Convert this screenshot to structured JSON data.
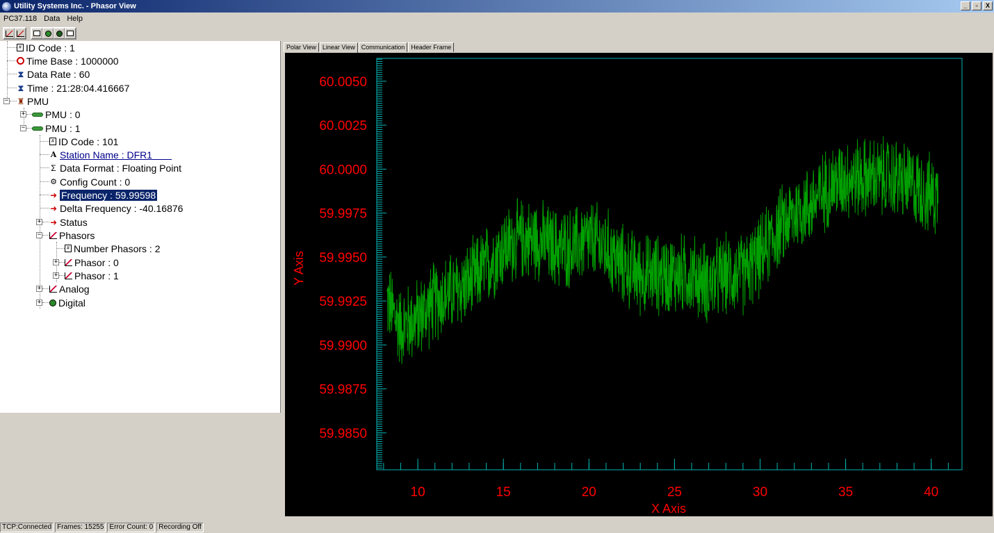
{
  "window": {
    "title": "Utility Systems Inc. - Phasor View",
    "controls": [
      "_",
      "▫",
      "X"
    ]
  },
  "menu": [
    "PC37.118",
    "Data",
    "Help"
  ],
  "toolbar": {
    "icons": [
      "chart-view-icon",
      "data-view-icon",
      "table-icon",
      "connect-icon",
      "record-icon",
      "report-icon"
    ]
  },
  "tree": {
    "id_code": "ID Code : 1",
    "time_base": "Time Base : 1000000",
    "data_rate": "Data Rate : 60",
    "time": "Time : 21:28:04.416667",
    "pmu": "PMU",
    "pmu0": "PMU : 0",
    "pmu1": "PMU : 1",
    "pmu1_id_code": "ID Code : 101",
    "station_name": "Station Name : DFR1",
    "data_format": "Data Format : Floating Point",
    "config_count": "Config Count : 0",
    "frequency": "Frequency : 59.99598",
    "delta_frequency": "Delta Frequency : -40.16876",
    "status": "Status",
    "phasors": "Phasors",
    "number_phasors": "Number Phasors : 2",
    "phasor0": "Phasor : 0",
    "phasor1": "Phasor : 1",
    "analog": "Analog",
    "digital": "Digital"
  },
  "tabs": [
    "Polar View",
    "Linear View",
    "Communication",
    "Header Frame"
  ],
  "active_tab": "Linear View",
  "chart_data": {
    "type": "line",
    "xlabel": "X Axis",
    "ylabel": "Y Axis",
    "xlim": [
      7.6,
      41.8
    ],
    "ylim": [
      59.9829,
      60.0063
    ],
    "x_ticks": [
      10,
      15,
      20,
      25,
      30,
      35,
      40
    ],
    "y_ticks": [
      "59.9850",
      "59.9875",
      "59.9900",
      "59.9925",
      "59.9950",
      "59.9975",
      "60.0000",
      "60.0025",
      "60.0050"
    ],
    "series": [
      {
        "color": "#00a000",
        "x_start": 8.2,
        "x_end": 40.4,
        "trend_x": [
          8.2,
          9,
          10,
          11,
          12,
          13,
          14,
          15,
          16,
          17,
          18,
          19,
          20,
          21,
          22,
          23,
          24,
          25,
          26,
          27,
          28,
          29,
          30,
          31,
          32,
          33,
          34,
          35,
          36,
          37,
          38,
          39,
          40,
          40.4
        ],
        "trend_y": [
          59.9925,
          59.991,
          59.9915,
          59.9925,
          59.993,
          59.9935,
          59.9945,
          59.9955,
          59.996,
          59.996,
          59.9955,
          59.9955,
          59.996,
          59.9955,
          59.9945,
          59.994,
          59.994,
          59.994,
          59.994,
          59.9935,
          59.994,
          59.994,
          59.995,
          59.9965,
          59.9975,
          59.998,
          59.999,
          59.9995,
          59.9995,
          59.9995,
          59.9995,
          59.999,
          59.9985,
          59.9985
        ],
        "amplitude": 0.0022
      }
    ]
  },
  "statusbar": [
    "TCP:Connected",
    "Frames: 15255",
    "Error Count: 0",
    "Recording Off"
  ],
  "colors": {
    "titlebar_start": "#0a246a",
    "titlebar_end": "#a6caf0",
    "chart_bg": "#000000",
    "chart_frame": "#00b4b4",
    "axis_labels": "#ff0000",
    "line": "#00a000"
  }
}
